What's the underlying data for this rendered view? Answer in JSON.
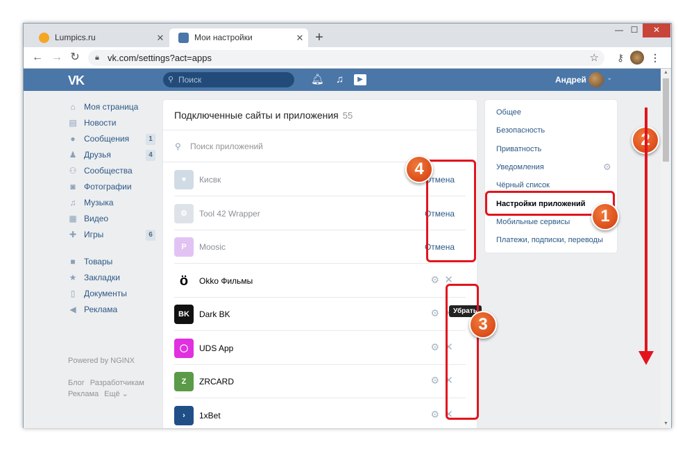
{
  "browser": {
    "tabs": [
      {
        "title": "Lumpics.ru",
        "close": "✕"
      },
      {
        "title": "Мои настройки",
        "close": "✕"
      }
    ],
    "new_tab": "+",
    "window_controls": {
      "minimize": "—",
      "maximize": "☐",
      "close": "✕"
    },
    "nav": {
      "back": "←",
      "forward": "→",
      "reload": "↻"
    },
    "url": "vk.com/settings?act=apps",
    "icons": [
      "lock-icon",
      "star-icon",
      "key-icon",
      "avatar-icon",
      "menu-icon"
    ]
  },
  "vk": {
    "logo": "VK",
    "search_placeholder": "Поиск",
    "user_name": "Андрей",
    "left_menu": [
      {
        "label": "Моя страница",
        "icon": "home-icon",
        "glyph": "⌂"
      },
      {
        "label": "Новости",
        "icon": "news-icon",
        "glyph": "▤"
      },
      {
        "label": "Сообщения",
        "icon": "messages-icon",
        "glyph": "●",
        "count": "1"
      },
      {
        "label": "Друзья",
        "icon": "friends-icon",
        "glyph": "♟",
        "count": "4"
      },
      {
        "label": "Сообщества",
        "icon": "groups-icon",
        "glyph": "⚇"
      },
      {
        "label": "Фотографии",
        "icon": "photo-icon",
        "glyph": "◙"
      },
      {
        "label": "Музыка",
        "icon": "music-icon",
        "glyph": "♫"
      },
      {
        "label": "Видео",
        "icon": "video-icon",
        "glyph": "▦"
      },
      {
        "label": "Игры",
        "icon": "games-icon",
        "glyph": "✚",
        "count": "6"
      }
    ],
    "left_menu_2": [
      {
        "label": "Товары",
        "icon": "goods-icon",
        "glyph": "■"
      },
      {
        "label": "Закладки",
        "icon": "bookmarks-icon",
        "glyph": "★"
      },
      {
        "label": "Документы",
        "icon": "documents-icon",
        "glyph": "▯"
      },
      {
        "label": "Реклама",
        "icon": "ads-icon",
        "glyph": "◀"
      }
    ],
    "powered": "Powered by NGINX",
    "footer": [
      "Блог",
      "Разработчикам",
      "Реклама",
      "Ещё ⌄"
    ]
  },
  "apps_panel": {
    "title": "Подключенные сайты и приложения",
    "count": "55",
    "search_placeholder": "Поиск приложений",
    "cancel_label": "Отмена",
    "tooltip": "Убрать",
    "apps": [
      {
        "name": "Кисвк",
        "state": "removed",
        "color": "#9ab0c8",
        "glyph": "♥"
      },
      {
        "name": "Tool 42 Wrapper",
        "state": "removed",
        "color": "#b7c2cf",
        "glyph": "⚙"
      },
      {
        "name": "Moosic",
        "state": "removed",
        "color": "#c07ae6",
        "glyph": "P"
      },
      {
        "name": "Okko Фильмы",
        "state": "active",
        "color": "#ffffff",
        "glyph": "ö"
      },
      {
        "name": "Dark BK",
        "state": "active",
        "color": "#111111",
        "glyph": "BK"
      },
      {
        "name": "UDS App",
        "state": "active",
        "color": "#e030e0",
        "glyph": "◯"
      },
      {
        "name": "ZRCARD",
        "state": "active",
        "color": "#5a9a48",
        "glyph": "Z"
      },
      {
        "name": "1xBet",
        "state": "active",
        "color": "#1f4f86",
        "glyph": "›"
      }
    ]
  },
  "settings_menu": [
    {
      "label": "Общее"
    },
    {
      "label": "Безопасность"
    },
    {
      "label": "Приватность"
    },
    {
      "label": "Уведомления",
      "gear": "⚙"
    },
    {
      "label": "Чёрный список"
    },
    {
      "label": "Настройки приложений",
      "selected": true
    },
    {
      "label": "Мобильные сервисы"
    },
    {
      "label": "Платежи, подписки, переводы"
    }
  ],
  "annotations": [
    "1",
    "2",
    "3",
    "4"
  ]
}
